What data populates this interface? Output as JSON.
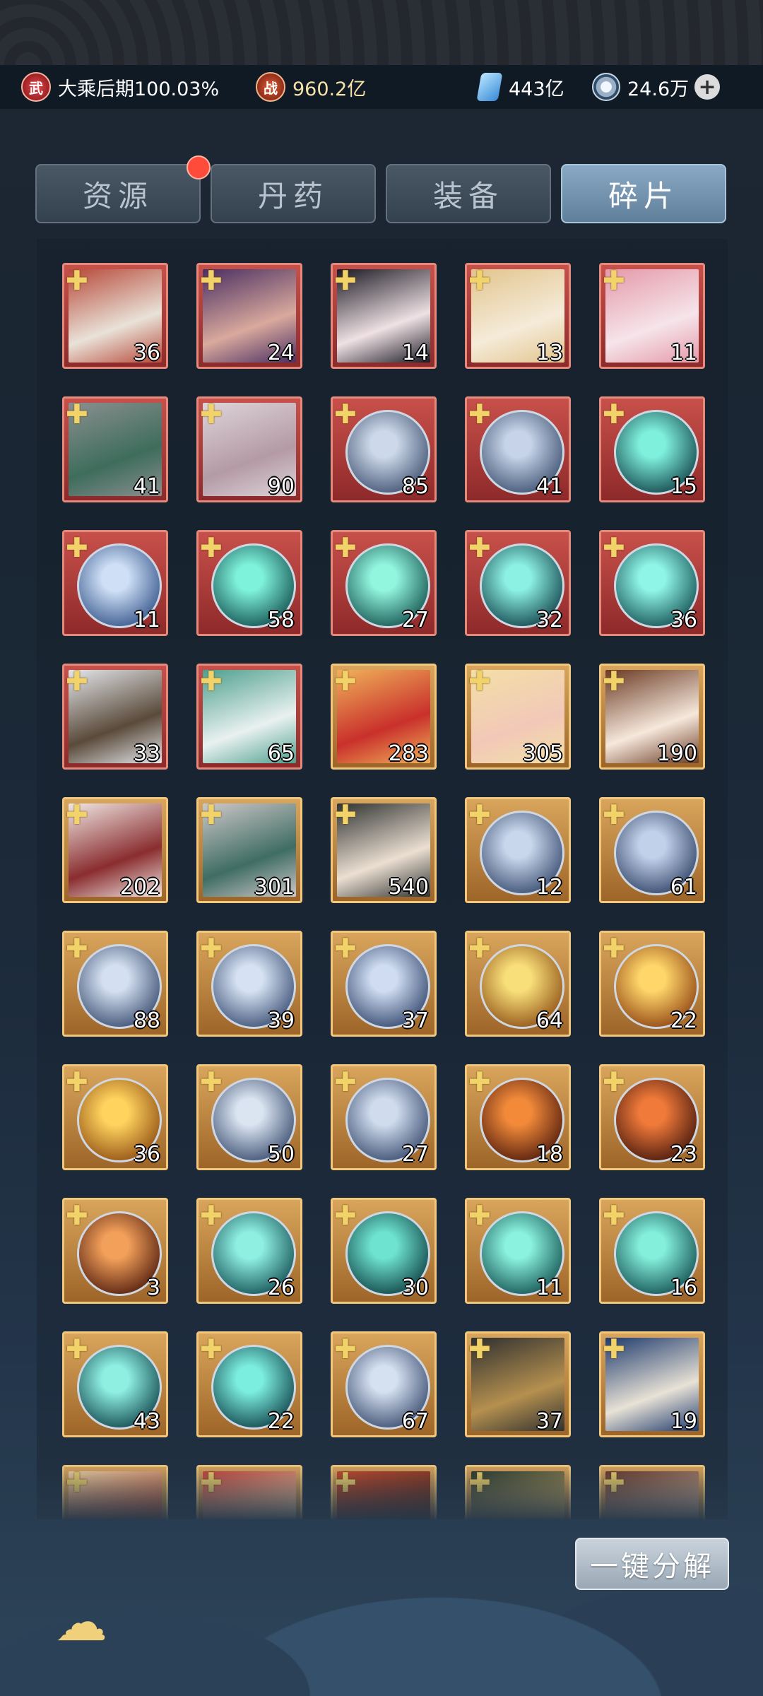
{
  "status": {
    "realm_badge": "武",
    "realm_text": "大乘后期100.03%",
    "power_badge": "战",
    "power_value": "960.2亿",
    "gem_value": "443亿",
    "coin_value": "24.6万",
    "plus_symbol": "+"
  },
  "tabs": [
    "资源",
    "丹药",
    "装备",
    "碎片"
  ],
  "active_tab": "碎片",
  "tiles": [
    {
      "kind": "portrait",
      "frame": "red",
      "count": "36",
      "c1": "#b74a3a",
      "c2": "#e9e2d8"
    },
    {
      "kind": "portrait",
      "frame": "red",
      "count": "24",
      "c1": "#4a2f62",
      "c2": "#d9a99d"
    },
    {
      "kind": "portrait",
      "frame": "red",
      "count": "14",
      "c1": "#1c1a24",
      "c2": "#efe1e4"
    },
    {
      "kind": "portrait",
      "frame": "red",
      "count": "13",
      "c1": "#e2c58e",
      "c2": "#f5ebd9"
    },
    {
      "kind": "portrait",
      "frame": "red",
      "count": "11",
      "c1": "#e49aa9",
      "c2": "#f6e4ea"
    },
    {
      "kind": "portrait",
      "frame": "red",
      "count": "41",
      "c1": "#8a8f8f",
      "c2": "#3e6d5c"
    },
    {
      "kind": "portrait",
      "frame": "red",
      "count": "90",
      "c1": "#ddd4d8",
      "c2": "#b49aa5"
    },
    {
      "kind": "orb",
      "frame": "red",
      "count": "85",
      "c1": "#cdd9ea",
      "c2": "#3b4d6d"
    },
    {
      "kind": "orb",
      "frame": "red",
      "count": "41",
      "c1": "#c6d3e8",
      "c2": "#364b6b"
    },
    {
      "kind": "orb",
      "frame": "red",
      "count": "15",
      "c1": "#7ff0dc",
      "c2": "#0e3e45"
    },
    {
      "kind": "orb",
      "frame": "red",
      "count": "11",
      "c1": "#cfe0f6",
      "c2": "#2e4f86"
    },
    {
      "kind": "orb",
      "frame": "red",
      "count": "58",
      "c1": "#7ff2db",
      "c2": "#0e4a4a"
    },
    {
      "kind": "orb",
      "frame": "red",
      "count": "27",
      "c1": "#92f5de",
      "c2": "#0f4d4a"
    },
    {
      "kind": "orb",
      "frame": "red",
      "count": "32",
      "c1": "#8cf0e3",
      "c2": "#0c3c45"
    },
    {
      "kind": "orb",
      "frame": "red",
      "count": "36",
      "c1": "#8ff5e6",
      "c2": "#0f4a4e"
    },
    {
      "kind": "portrait",
      "frame": "red",
      "count": "33",
      "c1": "#e3e6ea",
      "c2": "#5a4a3a"
    },
    {
      "kind": "portrait",
      "frame": "red",
      "count": "65",
      "c1": "#4fa08e",
      "c2": "#e9f1f0"
    },
    {
      "kind": "portrait",
      "frame": "gold",
      "count": "283",
      "c1": "#f0b15a",
      "c2": "#c9302b"
    },
    {
      "kind": "portrait",
      "frame": "gold",
      "count": "305",
      "c1": "#f3dfa6",
      "c2": "#f2c8b8"
    },
    {
      "kind": "portrait",
      "frame": "gold",
      "count": "190",
      "c1": "#6b3b24",
      "c2": "#f6e8dc"
    },
    {
      "kind": "portrait",
      "frame": "gold",
      "count": "202",
      "c1": "#efe6e2",
      "c2": "#8a2d2f"
    },
    {
      "kind": "portrait",
      "frame": "gold",
      "count": "301",
      "c1": "#cdc7c8",
      "c2": "#3f6d63"
    },
    {
      "kind": "portrait",
      "frame": "gold",
      "count": "540",
      "c1": "#2f3331",
      "c2": "#ecdfd2"
    },
    {
      "kind": "orb",
      "frame": "gold",
      "count": "12",
      "c1": "#c9d7ec",
      "c2": "#31466a"
    },
    {
      "kind": "orb",
      "frame": "gold",
      "count": "61",
      "c1": "#c2d1ea",
      "c2": "#2c3f63"
    },
    {
      "kind": "orb",
      "frame": "gold",
      "count": "88",
      "c1": "#d4e0f1",
      "c2": "#33476b"
    },
    {
      "kind": "orb",
      "frame": "gold",
      "count": "39",
      "c1": "#d6e2f3",
      "c2": "#354a70"
    },
    {
      "kind": "orb",
      "frame": "gold",
      "count": "37",
      "c1": "#cfdcf2",
      "c2": "#2d4268"
    },
    {
      "kind": "orb",
      "frame": "gold",
      "count": "64",
      "c1": "#f9df7a",
      "c2": "#8a4b10"
    },
    {
      "kind": "orb",
      "frame": "gold",
      "count": "22",
      "c1": "#ffd66a",
      "c2": "#8a3d0e"
    },
    {
      "kind": "orb",
      "frame": "gold",
      "count": "36",
      "c1": "#ffd35e",
      "c2": "#8c4910"
    },
    {
      "kind": "orb",
      "frame": "gold",
      "count": "50",
      "c1": "#dbe5f2",
      "c2": "#34476a"
    },
    {
      "kind": "orb",
      "frame": "gold",
      "count": "27",
      "c1": "#d0dcee",
      "c2": "#33466a"
    },
    {
      "kind": "orb",
      "frame": "gold",
      "count": "18",
      "c1": "#f28a3a",
      "c2": "#4a170a"
    },
    {
      "kind": "orb",
      "frame": "gold",
      "count": "23",
      "c1": "#f07a3a",
      "c2": "#3e130a"
    },
    {
      "kind": "orb",
      "frame": "gold",
      "count": "3",
      "c1": "#f3a05a",
      "c2": "#4a170a"
    },
    {
      "kind": "orb",
      "frame": "gold",
      "count": "26",
      "c1": "#8ff0e2",
      "c2": "#0f4a50"
    },
    {
      "kind": "orb",
      "frame": "gold",
      "count": "30",
      "c1": "#6ee3cf",
      "c2": "#0c3b40"
    },
    {
      "kind": "orb",
      "frame": "gold",
      "count": "11",
      "c1": "#8af2de",
      "c2": "#0f4c4c"
    },
    {
      "kind": "orb",
      "frame": "gold",
      "count": "16",
      "c1": "#84efdb",
      "c2": "#0f4a4c"
    },
    {
      "kind": "orb",
      "frame": "gold",
      "count": "43",
      "c1": "#8ff0e2",
      "c2": "#0c3f48"
    },
    {
      "kind": "orb",
      "frame": "gold",
      "count": "22",
      "c1": "#7ceee0",
      "c2": "#0c3c45"
    },
    {
      "kind": "orb",
      "frame": "gold",
      "count": "67",
      "c1": "#d5e0f0",
      "c2": "#33466a"
    },
    {
      "kind": "portrait",
      "frame": "gold",
      "count": "37",
      "c1": "#2f3030",
      "c2": "#b5904f"
    },
    {
      "kind": "portrait",
      "frame": "gold",
      "count": "19",
      "c1": "#1f3b6e",
      "c2": "#e8e2d6"
    },
    {
      "kind": "portrait",
      "frame": "gold",
      "count": "",
      "c1": "#f1d4a6",
      "c2": "#c65a3a"
    },
    {
      "kind": "portrait",
      "frame": "gold",
      "count": "",
      "c1": "#c9463a",
      "c2": "#f3d0a6"
    },
    {
      "kind": "portrait",
      "frame": "gold",
      "count": "",
      "c1": "#c94a2a",
      "c2": "#5a2a1a"
    },
    {
      "kind": "portrait",
      "frame": "gold",
      "count": "",
      "c1": "#2a3a2e",
      "c2": "#d2b060"
    },
    {
      "kind": "portrait",
      "frame": "gold",
      "count": "",
      "c1": "#6a3a2a",
      "c2": "#d8b49a"
    }
  ],
  "one_key_button": "一键分解",
  "bottom_icon": "cloud-icon"
}
